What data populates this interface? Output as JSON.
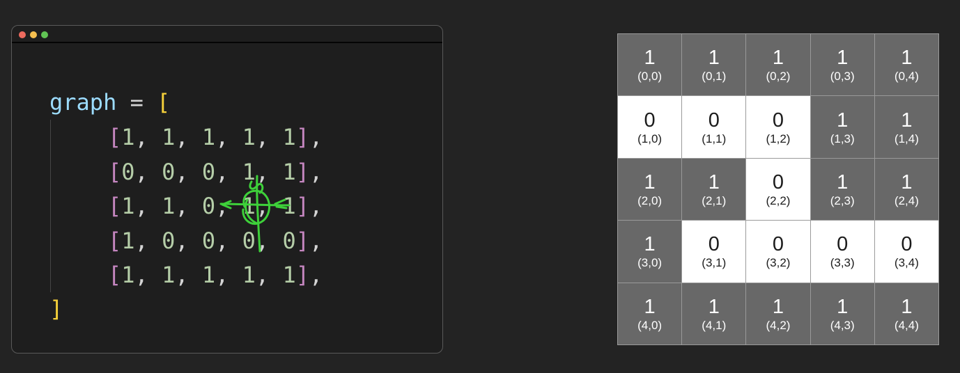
{
  "window": {
    "traffic_lights": {
      "close": "#ed6a5e",
      "minimize": "#f5bf4f",
      "zoom": "#61c454"
    }
  },
  "code": {
    "variable": "graph",
    "assign": "=",
    "open_bracket": "[",
    "close_bracket": "]",
    "rows": [
      [
        1,
        1,
        1,
        1,
        1
      ],
      [
        0,
        0,
        0,
        1,
        1
      ],
      [
        1,
        1,
        0,
        1,
        1
      ],
      [
        1,
        0,
        0,
        0,
        0
      ],
      [
        1,
        1,
        1,
        1,
        1
      ]
    ],
    "annotation": {
      "type": "hand-drawn-crosshair",
      "color": "#3ed13a",
      "target": "row 2, col 3"
    }
  },
  "grid": {
    "colors": {
      "one": "#686868",
      "zero": "#ffffff"
    },
    "cells": [
      [
        {
          "v": "1",
          "c": "(0,0)"
        },
        {
          "v": "1",
          "c": "(0,1)"
        },
        {
          "v": "1",
          "c": "(0,2)"
        },
        {
          "v": "1",
          "c": "(0,3)"
        },
        {
          "v": "1",
          "c": "(0,4)"
        }
      ],
      [
        {
          "v": "0",
          "c": "(1,0)"
        },
        {
          "v": "0",
          "c": "(1,1)"
        },
        {
          "v": "0",
          "c": "(1,2)"
        },
        {
          "v": "1",
          "c": "(1,3)"
        },
        {
          "v": "1",
          "c": "(1,4)"
        }
      ],
      [
        {
          "v": "1",
          "c": "(2,0)"
        },
        {
          "v": "1",
          "c": "(2,1)"
        },
        {
          "v": "0",
          "c": "(2,2)"
        },
        {
          "v": "1",
          "c": "(2,3)"
        },
        {
          "v": "1",
          "c": "(2,4)"
        }
      ],
      [
        {
          "v": "1",
          "c": "(3,0)"
        },
        {
          "v": "0",
          "c": "(3,1)"
        },
        {
          "v": "0",
          "c": "(3,2)"
        },
        {
          "v": "0",
          "c": "(3,3)"
        },
        {
          "v": "0",
          "c": "(3,4)"
        }
      ],
      [
        {
          "v": "1",
          "c": "(4,0)"
        },
        {
          "v": "1",
          "c": "(4,1)"
        },
        {
          "v": "1",
          "c": "(4,2)"
        },
        {
          "v": "1",
          "c": "(4,3)"
        },
        {
          "v": "1",
          "c": "(4,4)"
        }
      ]
    ]
  }
}
